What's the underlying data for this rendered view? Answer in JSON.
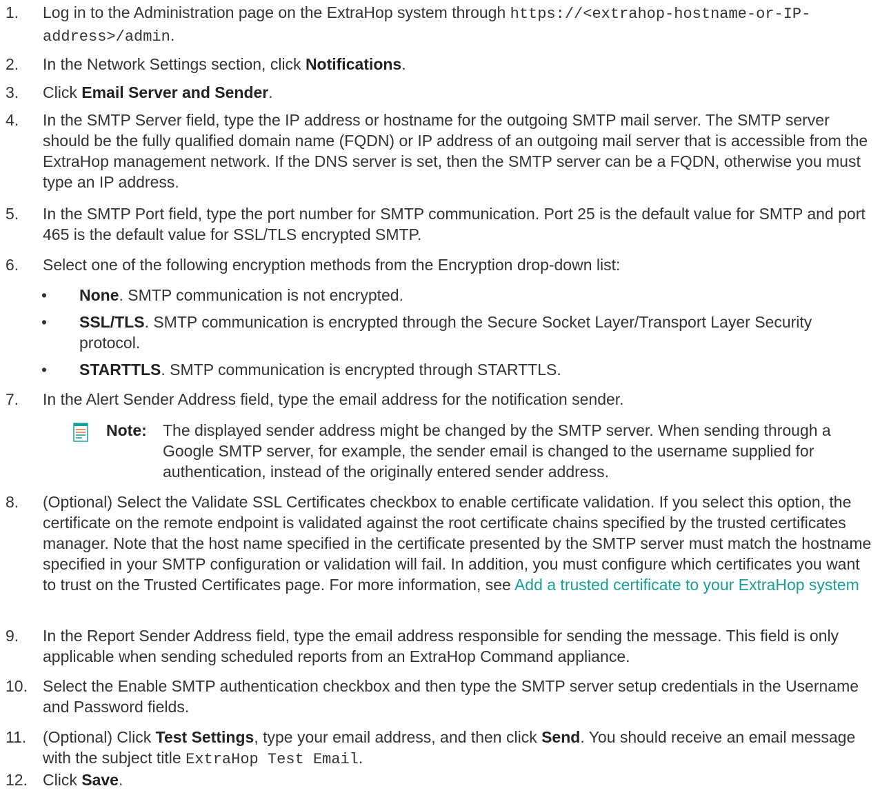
{
  "steps": [
    {
      "n": "1.",
      "a": "Log in to the Administration page on the ExtraHop system through ",
      "code": "https://<extrahop-hostname-or-IP-address>/admin",
      "b": "."
    },
    {
      "n": "2.",
      "a": "In the Network Settings section, click ",
      "bold": "Notifications",
      "b": "."
    },
    {
      "n": "3.",
      "a": "Click ",
      "bold": "Email Server and Sender",
      "b": "."
    },
    {
      "n": "4.",
      "text": "In the SMTP Server field, type the IP address or hostname for the outgoing SMTP mail server. The SMTP server should be the fully qualified domain name (FQDN) or IP address of an outgoing mail server that is accessible from the ExtraHop management network. If the DNS server is set, then the SMTP server can be a FQDN, otherwise you must type an IP address."
    },
    {
      "n": "5.",
      "text": "In the SMTP Port field, type the port number for SMTP communication. Port 25 is the default value for SMTP and port 465 is the default value for SSL/TLS encrypted SMTP."
    },
    {
      "n": "6.",
      "text": "Select one of the following encryption methods from the Encryption drop-down list:"
    },
    {
      "n": "7.",
      "text": "In the Alert Sender Address field, type the email address for the notification sender."
    },
    {
      "n": "8.",
      "text": "(Optional) Select the Validate SSL Certificates checkbox to enable certificate validation. If you select this option, the certificate on the remote endpoint is validated against the root certificate chains specified by the trusted certificates manager. Note that the host name specified in the certificate presented by the SMTP server must match the hostname specified in your SMTP configuration or validation will fail. In addition, you must configure which certificates you want to trust on the Trusted Certificates page. For more information, see ",
      "link": "Add a trusted certificate to your ExtraHop system"
    },
    {
      "n": "9.",
      "text": "In the Report Sender Address field, type the email address responsible for sending the message. This field is only applicable when sending scheduled reports from an ExtraHop Command appliance."
    },
    {
      "n": "10.",
      "text": "Select the Enable SMTP authentication checkbox and then type the SMTP server setup credentials in the Username and Password fields."
    },
    {
      "n": "11.",
      "a": "(Optional) Click ",
      "bold": "Test Settings",
      "b": ", type your email address, and then click ",
      "bold2": "Send",
      "c": ". You should receive an email message with the subject title ",
      "code": "ExtraHop Test Email",
      "d": "."
    },
    {
      "n": "12.",
      "a": "Click ",
      "bold": "Save",
      "b": "."
    }
  ],
  "bullets": [
    {
      "bold": "None",
      "text": ". SMTP communication is not encrypted."
    },
    {
      "bold": "SSL/TLS",
      "text": ". SMTP communication is encrypted through the Secure Socket Layer/Transport Layer Security protocol."
    },
    {
      "bold": "STARTTLS",
      "text": ". SMTP communication is encrypted through STARTTLS."
    }
  ],
  "note": {
    "label": "Note:",
    "text": "The displayed sender address might be changed by the SMTP server. When sending through a Google SMTP server, for example, the sender email is changed to the username supplied for authentication, instead of the originally entered sender address.",
    "icon": "note-icon"
  },
  "colors": {
    "text": "#333333",
    "link": "#1a9e99",
    "icon": "#1a9e99"
  }
}
